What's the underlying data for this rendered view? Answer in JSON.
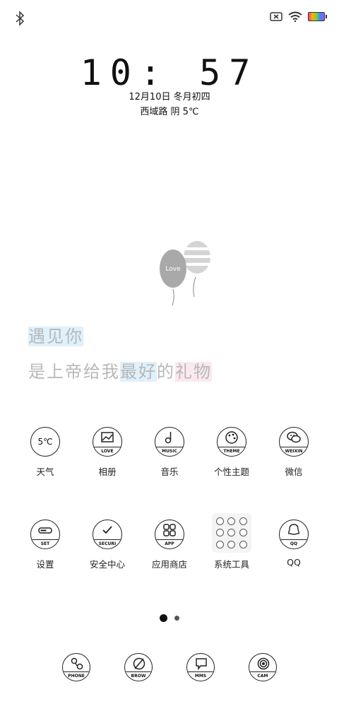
{
  "status_bar": {
    "left_icons": [
      "bluetooth-icon"
    ],
    "right_icons": [
      "sim-none-icon",
      "wifi-icon",
      "battery-charging-icon"
    ]
  },
  "lock_clock": {
    "time": "10: 57",
    "date": "12月10日 冬月初四",
    "weather": "西域路 阴 5℃"
  },
  "wallpaper": {
    "balloon_text": "Love",
    "line1": "遇见你",
    "line2_a": "是上帝给我",
    "line2_b": "最好",
    "line2_c": "的",
    "line2_d": "礼物"
  },
  "apps_row1": [
    {
      "label": "天气",
      "icon_text": "5℃",
      "icon": "weather-icon"
    },
    {
      "label": "相册",
      "icon_band": "LOVE",
      "icon": "gallery-icon"
    },
    {
      "label": "音乐",
      "icon_band": "MUSIC",
      "icon": "music-icon"
    },
    {
      "label": "个性主题",
      "icon_band": "THEME",
      "icon": "theme-icon"
    },
    {
      "label": "微信",
      "icon_band": "WEIXIN",
      "icon": "wechat-icon"
    }
  ],
  "apps_row2": [
    {
      "label": "设置",
      "icon_band": "SET",
      "icon": "settings-icon"
    },
    {
      "label": "安全中心",
      "icon_band": "SECURI",
      "icon": "security-icon"
    },
    {
      "label": "应用商店",
      "icon_band": "APP",
      "icon": "app-store-icon"
    },
    {
      "label": "系统工具",
      "icon": "folder-icon"
    },
    {
      "label": "QQ",
      "icon_band": "QQ",
      "icon": "qq-icon"
    }
  ],
  "pager": {
    "current": 1,
    "total": 2
  },
  "dock": [
    {
      "icon_band": "PHONE",
      "icon": "phone-icon"
    },
    {
      "icon_band": "BROW",
      "icon": "browser-icon"
    },
    {
      "icon_band": "MMS",
      "icon": "message-icon"
    },
    {
      "icon_band": "CAM",
      "icon": "camera-icon"
    }
  ],
  "colors": {
    "accent_blue": "#dff1fb",
    "accent_pink": "#fbe9ef",
    "line": "#222222"
  }
}
